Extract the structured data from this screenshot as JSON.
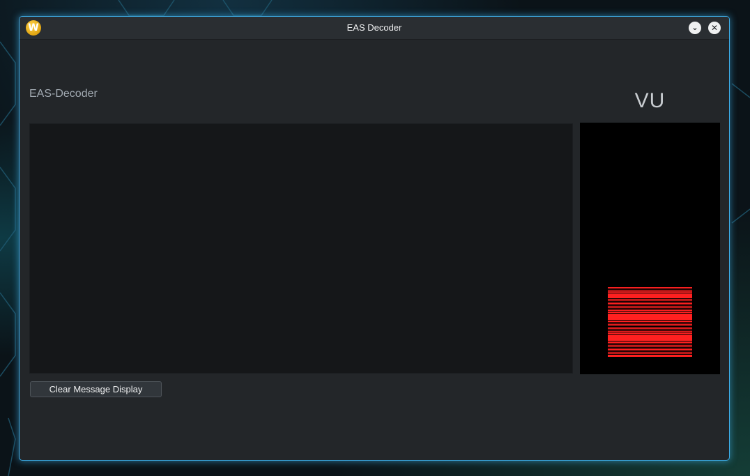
{
  "window": {
    "title": "EAS Decoder",
    "app_icon_letter": "W",
    "minimize_icon": "chevron-down-icon",
    "close_icon": "close-icon"
  },
  "decoder": {
    "section_label": "EAS-Decoder",
    "message_text": ""
  },
  "vu_meter": {
    "label": "VU",
    "level": 0.27,
    "bar_color": "#ff2020"
  },
  "buttons": {
    "clear_label": "Clear Message Display"
  },
  "colors": {
    "accent": "#3daee9",
    "window_bg": "#232629",
    "vu_bar": "#ff2020"
  }
}
